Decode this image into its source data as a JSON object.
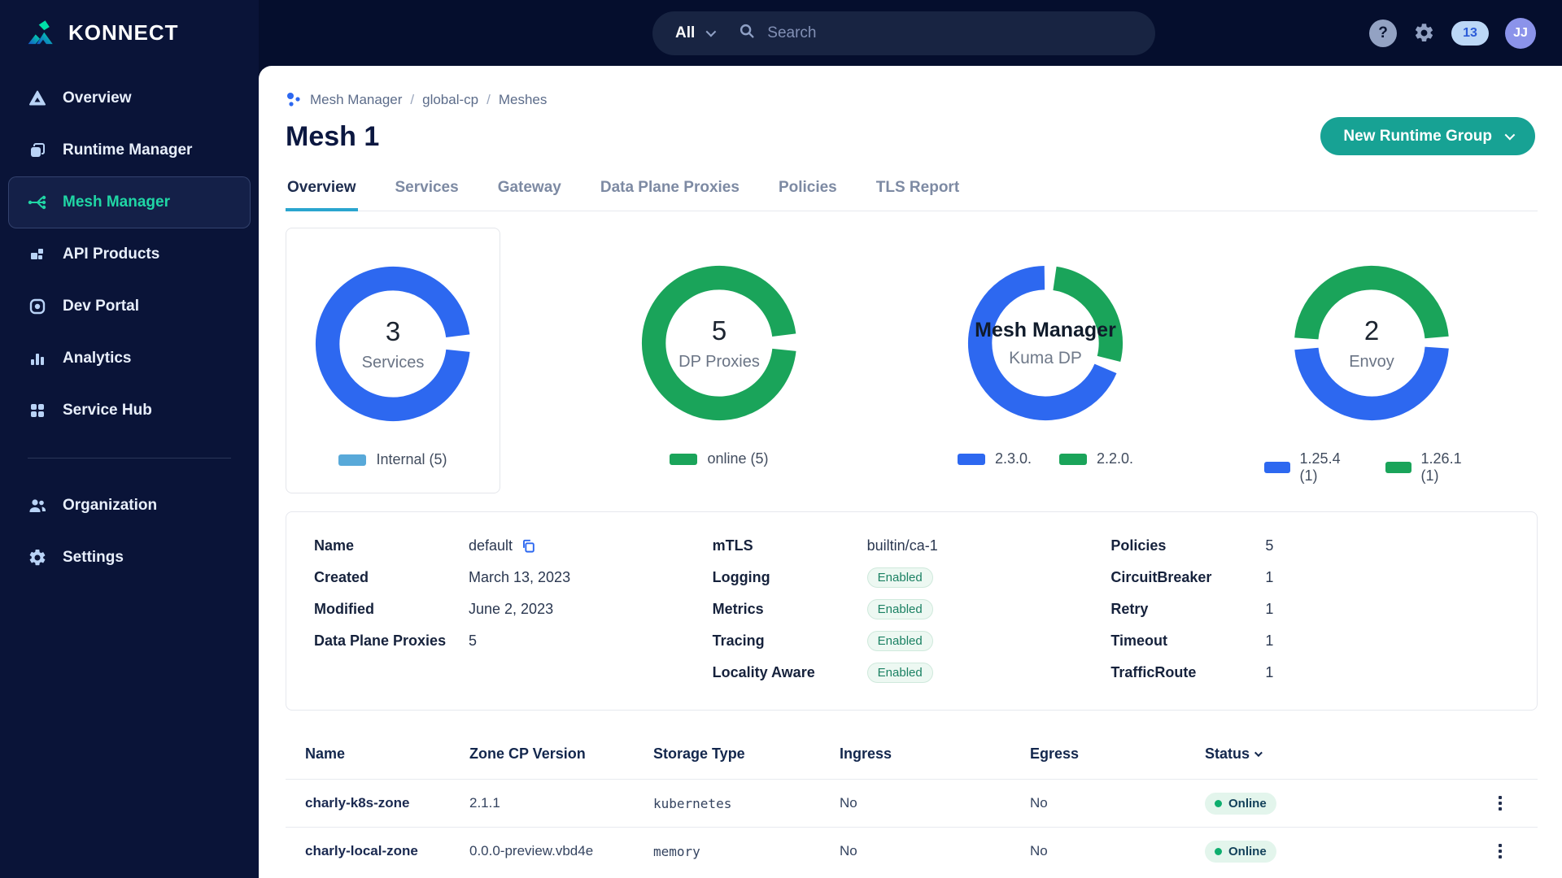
{
  "colors": {
    "topbar_bg": "#050e2d",
    "sidebar_bg": "#0a1438",
    "active_teal": "#20d6a5",
    "button_teal": "#17a294",
    "tab_underline": "#2aa5cf",
    "blue": "#2d68f0",
    "green": "#1aa45a",
    "lightblue": "#58a9d9",
    "online_dot": "#0eae6e",
    "avatar_bg": "#8b93ea"
  },
  "topbar": {
    "search_scope": "All",
    "search_placeholder": "Search",
    "help_label": "?",
    "notification_count": "13",
    "avatar_initials": "JJ"
  },
  "sidebar": {
    "brand": "KONNECT",
    "items": [
      {
        "label": "Overview",
        "active": false
      },
      {
        "label": "Runtime Manager",
        "active": false
      },
      {
        "label": "Mesh Manager",
        "active": true
      },
      {
        "label": "API Products",
        "active": false
      },
      {
        "label": "Dev Portal",
        "active": false
      },
      {
        "label": "Analytics",
        "active": false
      },
      {
        "label": "Service Hub",
        "active": false
      }
    ],
    "footer_items": [
      {
        "label": "Organization"
      },
      {
        "label": "Settings"
      }
    ]
  },
  "page": {
    "breadcrumb": [
      "Mesh Manager",
      "global-cp",
      "Meshes"
    ],
    "separator": "/",
    "title": "Mesh 1",
    "primary_action": "New Runtime Group",
    "tabs": [
      {
        "label": "Overview",
        "active": true
      },
      {
        "label": "Services",
        "active": false
      },
      {
        "label": "Gateway",
        "active": false
      },
      {
        "label": "Data Plane Proxies",
        "active": false
      },
      {
        "label": "Policies",
        "active": false
      },
      {
        "label": "TLS Report",
        "active": false
      }
    ]
  },
  "chart_data": [
    {
      "type": "donut",
      "center_value": "3",
      "center_label": "Services",
      "segments": [
        {
          "label": "Internal (5)",
          "value": 5,
          "fraction": 1,
          "color": "blue",
          "legend_color": "lightblue"
        }
      ],
      "layout": {
        "start_angle": 96,
        "gap_deg": 13,
        "legend_position": "bottom",
        "card_border": true
      }
    },
    {
      "type": "donut",
      "center_value": "5",
      "center_label": "DP Proxies",
      "segments": [
        {
          "label": "online (5)",
          "value": 5,
          "fraction": 1,
          "color": "green",
          "legend_color": "green"
        }
      ],
      "layout": {
        "start_angle": 96,
        "gap_deg": 13,
        "legend_position": "bottom",
        "card_border": false
      }
    },
    {
      "type": "donut",
      "center_value": "Mesh Manager",
      "center_label": "Kuma DP",
      "segments": [
        {
          "label": "2.3.0.",
          "fraction": 0.72,
          "color": "blue",
          "legend_color": "blue"
        },
        {
          "label": "2.2.0.",
          "fraction": 0.28,
          "color": "green",
          "legend_color": "green"
        }
      ],
      "layout": {
        "start_angle": 113,
        "gap_deg": 9,
        "legend_position": "bottom",
        "card_border": false
      }
    },
    {
      "type": "donut",
      "center_value": "2",
      "center_label": "Envoy",
      "segments": [
        {
          "label": "1.25.4 (1)",
          "value": 1,
          "fraction": 0.5,
          "color": "blue",
          "legend_color": "blue"
        },
        {
          "label": "1.26.1 (1)",
          "value": 1,
          "fraction": 0.5,
          "color": "green",
          "legend_color": "green"
        }
      ],
      "layout": {
        "start_angle": 94,
        "gap_deg": 9,
        "legend_position": "bottom",
        "card_border": false
      }
    }
  ],
  "details": {
    "left": [
      {
        "label": "Name",
        "value": "default"
      },
      {
        "label": "Created",
        "value": "March 13, 2023"
      },
      {
        "label": "Modified",
        "value": "June 2, 2023"
      },
      {
        "label": "Data Plane Proxies",
        "value": "5"
      }
    ],
    "middle": [
      {
        "label": "mTLS",
        "value": "builtin/ca-1"
      },
      {
        "label": "Logging",
        "value": "Enabled"
      },
      {
        "label": "Metrics",
        "value": "Enabled"
      },
      {
        "label": "Tracing",
        "value": "Enabled"
      },
      {
        "label": "Locality Aware",
        "value": "Enabled"
      }
    ],
    "right": [
      {
        "label": "Policies",
        "value": "5"
      },
      {
        "label": "CircuitBreaker",
        "value": "1"
      },
      {
        "label": "Retry",
        "value": "1"
      },
      {
        "label": "Timeout",
        "value": "1"
      },
      {
        "label": "TrafficRoute",
        "value": "1"
      }
    ]
  },
  "table": {
    "headers": [
      "Name",
      "Zone CP Version",
      "Storage Type",
      "Ingress",
      "Egress",
      "Status"
    ],
    "rows": [
      {
        "name": "charly-k8s-zone",
        "zone_cp_version": "2.1.1",
        "storage_type": "kubernetes",
        "ingress": "No",
        "egress": "No",
        "status": "Online"
      },
      {
        "name": "charly-local-zone",
        "zone_cp_version": "0.0.0-preview.vbd4e",
        "storage_type": "memory",
        "ingress": "No",
        "egress": "No",
        "status": "Online"
      }
    ]
  }
}
